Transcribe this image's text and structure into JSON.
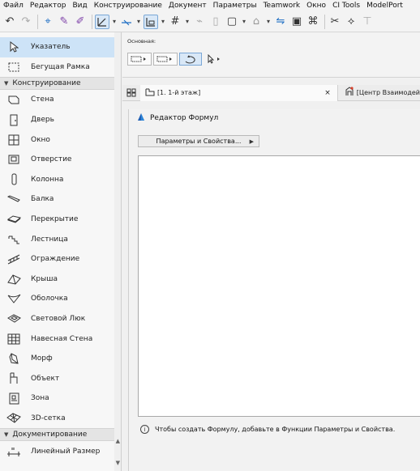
{
  "menu": [
    "Файл",
    "Редактор",
    "Вид",
    "Конструирование",
    "Документ",
    "Параметры",
    "Teamwork",
    "Окно",
    "CI Tools",
    "ModelPort"
  ],
  "toolbox": {
    "top_tools": [
      {
        "label": "Указатель",
        "icon": "arrow-pointer-icon",
        "active": true
      },
      {
        "label": "Бегущая Рамка",
        "icon": "marquee-icon",
        "active": false
      }
    ],
    "groups": [
      {
        "label": "Конструирование",
        "items": [
          {
            "label": "Стена",
            "icon": "wall-icon"
          },
          {
            "label": "Дверь",
            "icon": "door-icon"
          },
          {
            "label": "Окно",
            "icon": "window-icon"
          },
          {
            "label": "Отверстие",
            "icon": "opening-icon"
          },
          {
            "label": "Колонна",
            "icon": "column-icon"
          },
          {
            "label": "Балка",
            "icon": "beam-icon"
          },
          {
            "label": "Перекрытие",
            "icon": "slab-icon"
          },
          {
            "label": "Лестница",
            "icon": "stair-icon"
          },
          {
            "label": "Ограждение",
            "icon": "railing-icon"
          },
          {
            "label": "Крыша",
            "icon": "roof-icon"
          },
          {
            "label": "Оболочка",
            "icon": "shell-icon"
          },
          {
            "label": "Световой Люк",
            "icon": "skylight-icon"
          },
          {
            "label": "Навесная Стена",
            "icon": "curtain-wall-icon"
          },
          {
            "label": "Морф",
            "icon": "morph-icon"
          },
          {
            "label": "Объект",
            "icon": "object-icon"
          },
          {
            "label": "Зона",
            "icon": "zone-icon"
          },
          {
            "label": "3D-сетка",
            "icon": "mesh-icon"
          }
        ]
      },
      {
        "label": "Документирование",
        "items": [
          {
            "label": "Линейный Размер",
            "icon": "dimension-icon"
          }
        ]
      }
    ]
  },
  "infobox": {
    "label": "Основная:"
  },
  "tabs": [
    {
      "label": "[1. 1-й этаж]",
      "icon": "floor-plan-icon",
      "close": "×"
    },
    {
      "label": "[Центр Взаимодей",
      "icon": "organizer-icon"
    }
  ],
  "formula_editor": {
    "title": "Редактор Формул",
    "menu_button": "Параметры и Свойства...",
    "formula_text": "",
    "hint_icon": "i",
    "hint": "Чтобы создать Формулу, добавьте в Функции Параметры и Свойства."
  }
}
